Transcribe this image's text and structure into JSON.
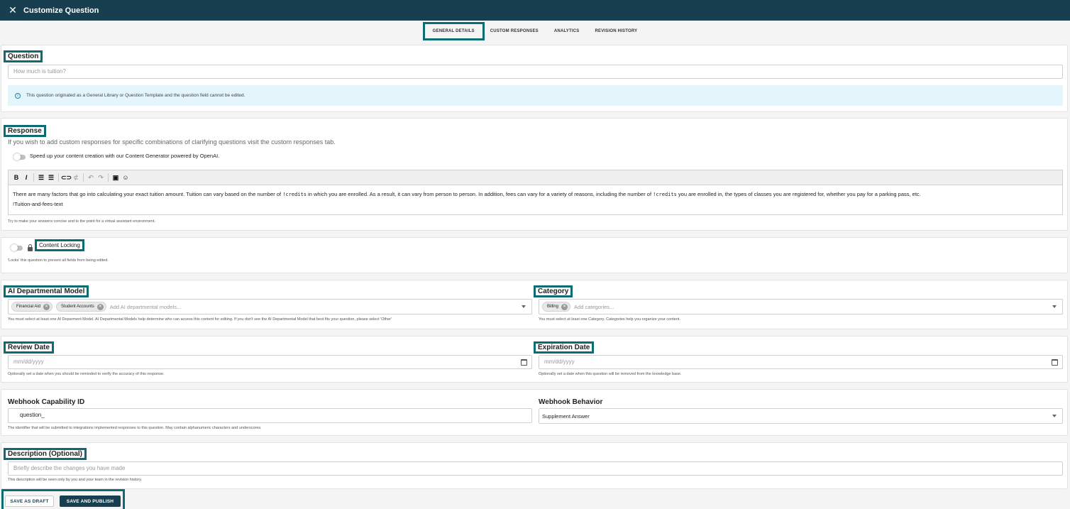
{
  "header": {
    "title": "Customize Question",
    "close_icon": "close-icon"
  },
  "tabs": [
    "GENERAL DETAILS",
    "CUSTOM RESPONSES",
    "ANALYTICS",
    "REVISION HISTORY"
  ],
  "question": {
    "label": "Question",
    "placeholder": "How much is tuition?",
    "info": "This question originated as a General Library or Question Template and the question field cannot be edited."
  },
  "response": {
    "label": "Response",
    "intro": "If you wish to add custom responses for specific combinations of clarifying questions visit the custom responses tab.",
    "generator_toggle": "Speed up your content creation with our Content Generator powered by OpenAI.",
    "toolbar": [
      "B",
      "I",
      "bulleted-list",
      "numbered-list",
      "link",
      "unlink",
      "undo",
      "redo",
      "embed",
      "emoji"
    ],
    "body_part1": "There are many factors that go into calculating your exact tuition amount. Tuition can vary based on the number of ",
    "body_code1": "!credits",
    "body_part2": " in which you are enrolled. As a result, it can vary from person to person. In addition, fees can vary for a variety of reasons, including the number of ",
    "body_code2": "!credits",
    "body_part3": " you are enrolled in, the types of classes you are registered for, whether you pay for a parking pass, etc.",
    "body_line2": "!Tuition-and-fees-text",
    "help": "Try to make your answers concise and to the point for a virtual assistant environment."
  },
  "locking": {
    "label": "Content Locking",
    "help": "'Locks' this question to prevent all fields from being edited."
  },
  "ai_model": {
    "label": "AI Departmental Model",
    "chips": [
      "Financial Aid",
      "Student Accounts"
    ],
    "placeholder": "Add AI departmental models...",
    "help": "You must select at least one AI Deparment Model. AI Departmental Models help determine who can access this content for editing. If you don't see the AI Departmental Model that best fits your question, please select 'Other'"
  },
  "category": {
    "label": "Category",
    "chips": [
      "Billing"
    ],
    "placeholder": "Add categories...",
    "help": "You must select at least one Category. Categories help you organize your content."
  },
  "review_date": {
    "label": "Review Date",
    "placeholder": "mm/dd/yyyy",
    "help": "Optionally set a date when you should be reminded to verify the accuracy of this response."
  },
  "expiration_date": {
    "label": "Expiration Date",
    "placeholder": "mm/dd/yyyy",
    "help": "Optionally set a date when this question will be removed from the knowledge base."
  },
  "webhook_id": {
    "label": "Webhook Capability ID",
    "value": "question_",
    "help": "The identifier that will be submitted to integrations implemented responses to this question. May contain alphanumeric characters and underscores."
  },
  "webhook_behavior": {
    "label": "Webhook Behavior",
    "value": "Supplement Answer"
  },
  "description": {
    "label": "Description (Optional)",
    "placeholder": "Briefly describe the changes you have made",
    "help": "This description will be seen only by you and your team in the revision history."
  },
  "buttons": {
    "draft": "SAVE AS DRAFT",
    "publish": "SAVE AND PUBLISH"
  },
  "colors": {
    "header_bg": "#173f4f",
    "highlight": "#0d6b73",
    "publish_bg": "#173f4f"
  }
}
